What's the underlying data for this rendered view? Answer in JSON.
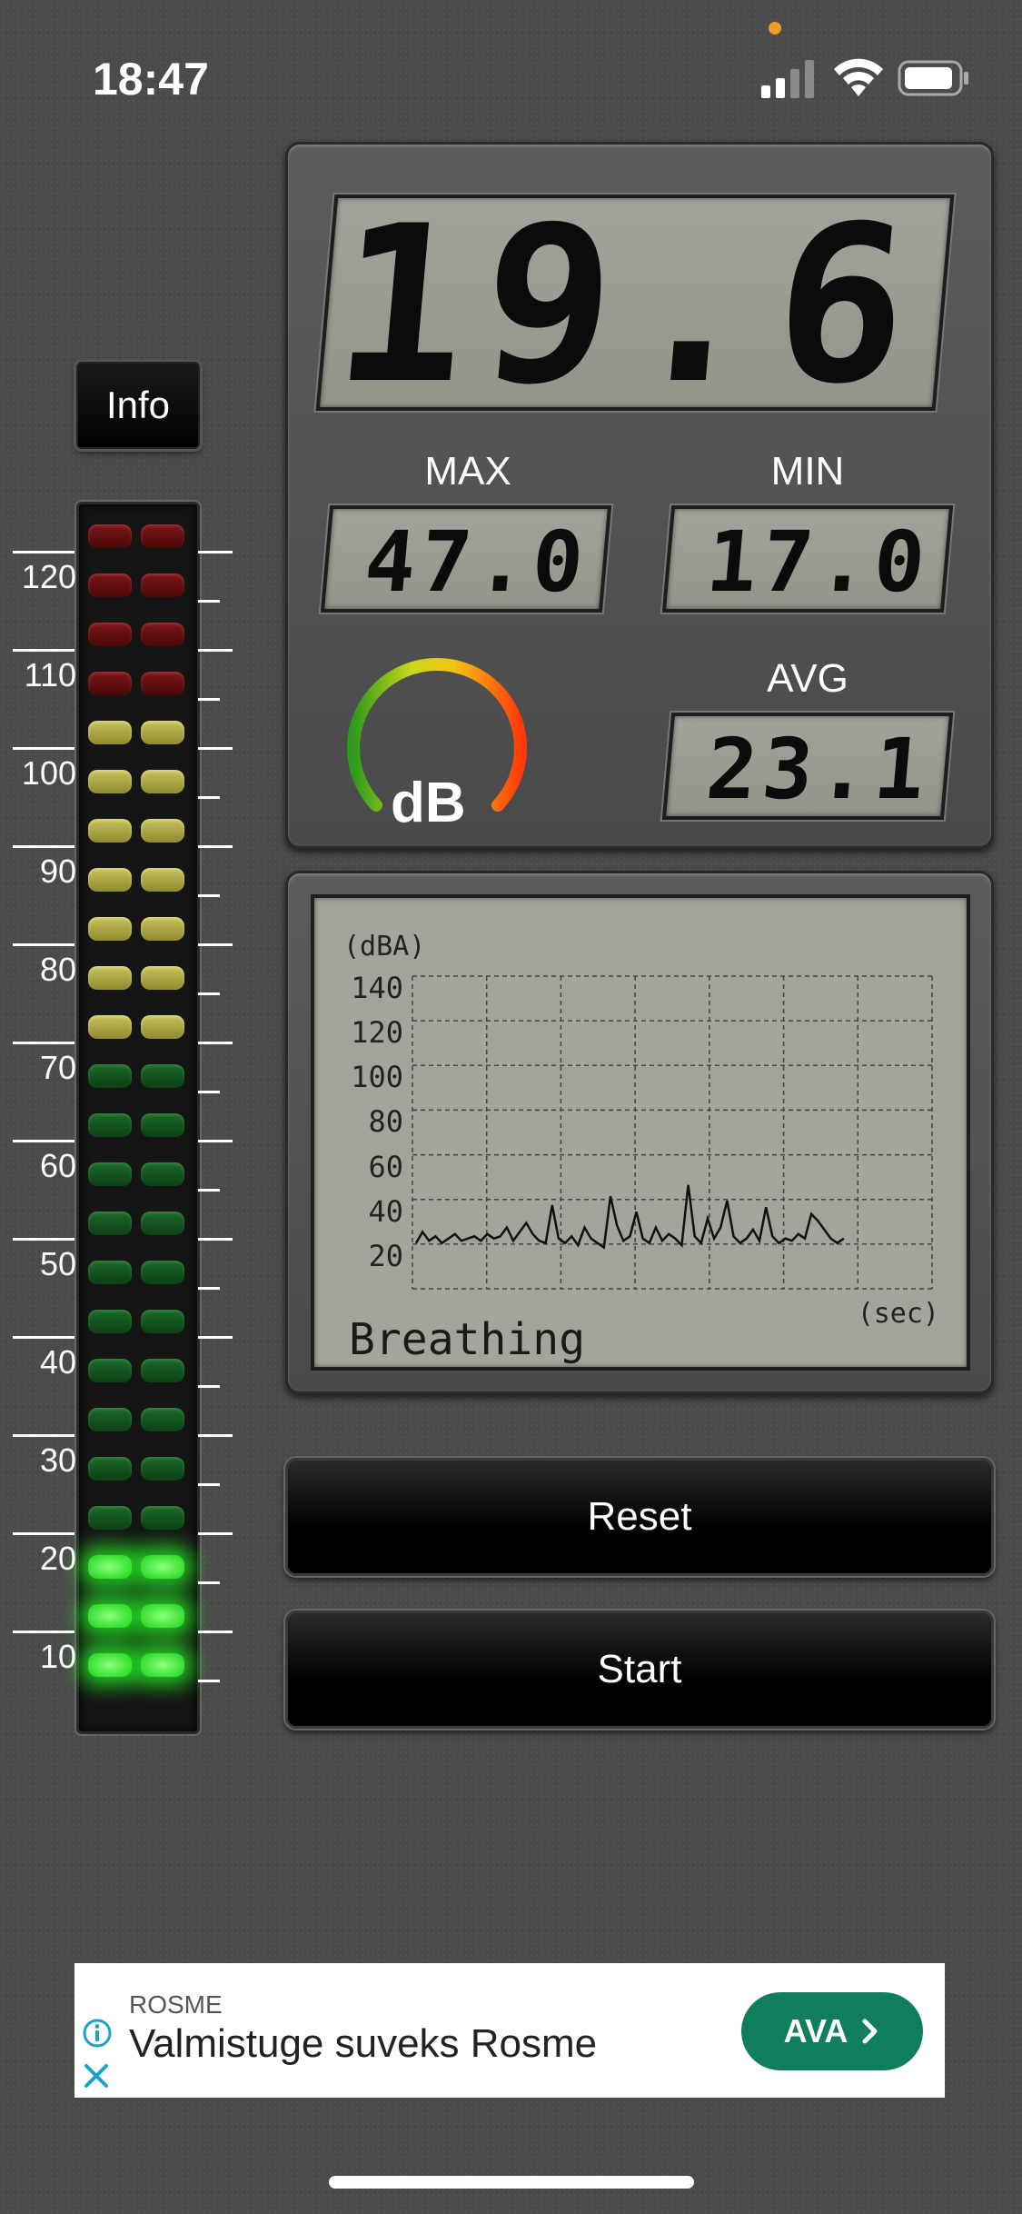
{
  "status_bar": {
    "time": "18:47"
  },
  "info_button": {
    "label": "Info"
  },
  "meter": {
    "scale": [
      "120",
      "110",
      "100",
      "90",
      "80",
      "70",
      "60",
      "50",
      "40",
      "30",
      "20",
      "10"
    ],
    "level_db": 19.6
  },
  "display": {
    "current": "19.6",
    "max_label": "MAX",
    "max_value": "47.0",
    "min_label": "MIN",
    "min_value": "17.0",
    "avg_label": "AVG",
    "avg_value": "23.1",
    "unit_label": "dB"
  },
  "graph": {
    "unit": "(dBA)",
    "x_unit": "(sec)",
    "y_ticks": [
      "140",
      "120",
      "100",
      "80",
      "60",
      "40",
      "20"
    ],
    "annotation": "Breathing",
    "samples": [
      27,
      32,
      28,
      30,
      27,
      29,
      31,
      28,
      29,
      30,
      28,
      31,
      29,
      30,
      34,
      28,
      32,
      36,
      31,
      28,
      27,
      44,
      29,
      27,
      30,
      26,
      34,
      29,
      27,
      25,
      48,
      35,
      28,
      30,
      41,
      29,
      27,
      34,
      28,
      31,
      29,
      26,
      53,
      30,
      27,
      38,
      29,
      34,
      46,
      30,
      27,
      29,
      33,
      28,
      43,
      30,
      27,
      29,
      28,
      31,
      29,
      40,
      37,
      33,
      29,
      27,
      29
    ],
    "colors": {
      "line": "#111111",
      "grid": "#444444"
    }
  },
  "buttons": {
    "reset": "Reset",
    "start": "Start"
  },
  "ad": {
    "brand": "ROSME",
    "title": "Valmistuge suveks Rosme",
    "cta": "AVA",
    "accent": "#0f7e5d"
  }
}
